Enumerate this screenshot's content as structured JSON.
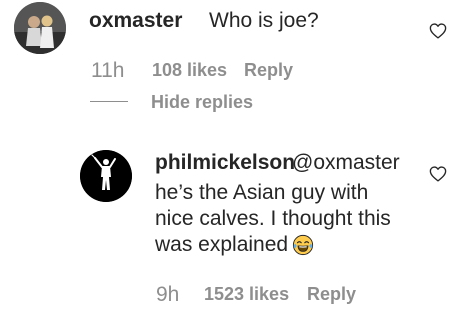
{
  "top_comment": {
    "username": "oxmaster",
    "text": "Who is joe?",
    "time": "11h",
    "likes": "108 likes",
    "reply_label": "Reply",
    "hide_replies_label": "Hide replies",
    "like_icon": "heart-outline-icon"
  },
  "reply_comment": {
    "username": "philmickelson",
    "mention": "@oxmaster",
    "lines": [
      "he’s the Asian guy with",
      "nice calves. I thought this",
      "was explained"
    ],
    "emoji": "face-with-tears-of-joy",
    "time": "9h",
    "likes": "1523 likes",
    "reply_label": "Reply",
    "like_icon": "heart-outline-icon"
  },
  "colors": {
    "text_primary": "#262626",
    "text_secondary": "#8e8e8e",
    "background": "#ffffff"
  }
}
